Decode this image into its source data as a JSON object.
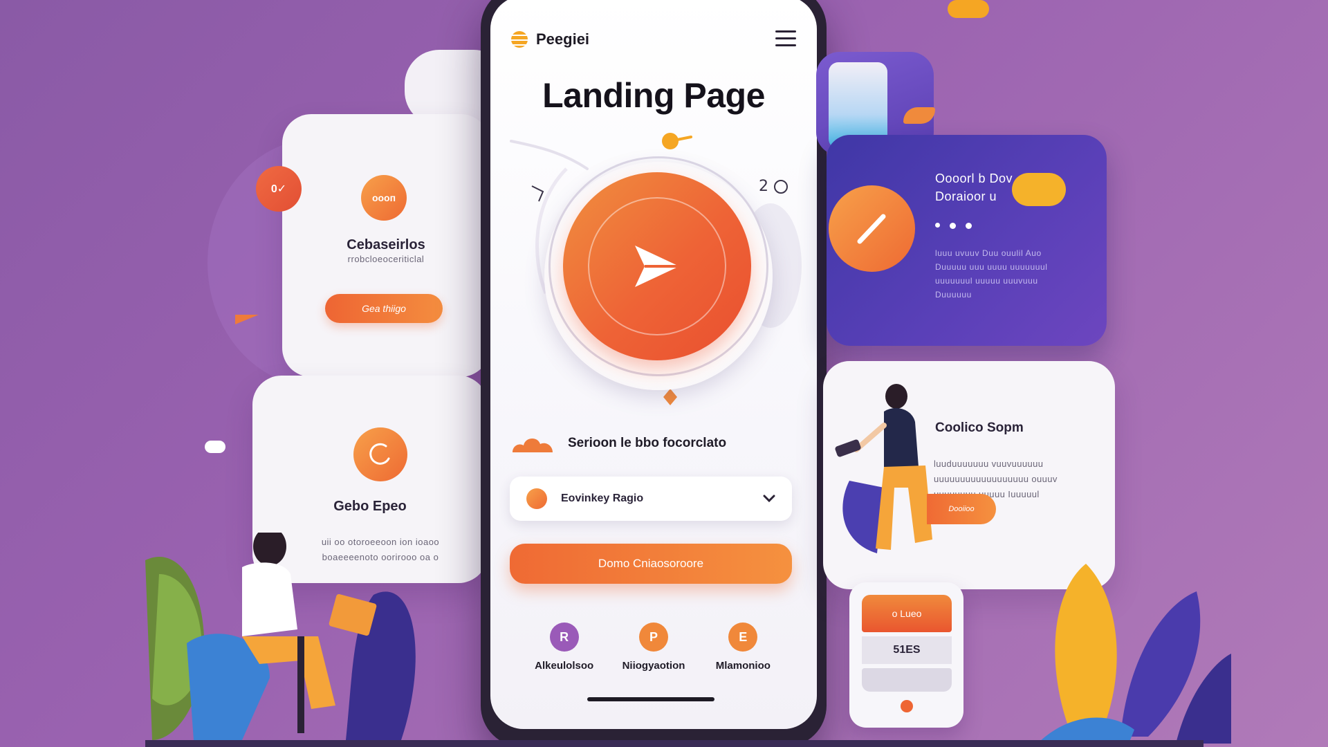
{
  "colors": {
    "background": "#9a62b0",
    "accent": "#ee6533",
    "accent_light": "#f5913f",
    "deep_purple": "#4a3bac",
    "text_dark": "#1d1a24"
  },
  "left_cards": {
    "top": {
      "icon_text": "оооп",
      "title": "Cebaseirlos",
      "subtitle": "rrobcloeoceriticlal",
      "button_label": "Gea thiigo"
    },
    "badge_text": "0✓",
    "bottom": {
      "title": "Gebo Epeo",
      "body_line1": "uii oo otoroeeoon ion ioaoo",
      "body_line2": "boaeeeenoto oorirooo oa o"
    }
  },
  "phone": {
    "brand_name": "Peegiei",
    "title": "Landing Page",
    "play_icon": "play-icon",
    "side_number": "2",
    "section_label": "Serioon le bbo focorclato",
    "dropdown_value": "Eovinkey Ragio",
    "cta_label": "Domo Cniaosoroore",
    "nav": [
      {
        "label": "Alkeulolsoo",
        "icon": "R",
        "color": "#9a5ab8"
      },
      {
        "label": "Niiogyaotion",
        "icon": "P",
        "color": "#f0883a"
      },
      {
        "label": "Mlamonioo",
        "icon": "E",
        "color": "#f0883a"
      }
    ]
  },
  "right_cards": {
    "top": {
      "heading_line1": "Oooorl b Dov",
      "heading_line2": "Doraioor u",
      "body": "luuu uvuuv Duu ouulil Auo Duuuuu uuu uuuu uuuuuuul uuuuuuul uuuuu uuuvuuu Duuuuuu"
    },
    "bottom": {
      "title": "Coolico Sopm",
      "body": "luuduuuuuuu vuuvuuuuuu uuuuuuuuuuuuuuuuuu ouuuv uuuuuuuu uuuuu Iuuuuul",
      "button_label": "Dooiioo"
    },
    "device": {
      "top_label": "o Lueo",
      "mid_label": "51ES"
    }
  }
}
